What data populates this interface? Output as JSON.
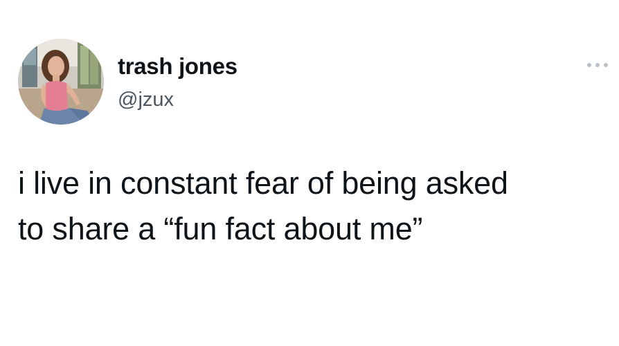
{
  "author": {
    "display_name": "trash jones",
    "handle": "@jzux",
    "avatar_icon": "profile-photo"
  },
  "tweet": {
    "lines": [
      "i live in constant fear of being asked",
      "to share a “fun fact about me”"
    ]
  },
  "menu": {
    "icon": "more-options-icon"
  },
  "colors": {
    "text": "#0f1419",
    "secondary_text": "#4b5660",
    "more_dots": "#b9c1c8",
    "background": "#ffffff"
  }
}
